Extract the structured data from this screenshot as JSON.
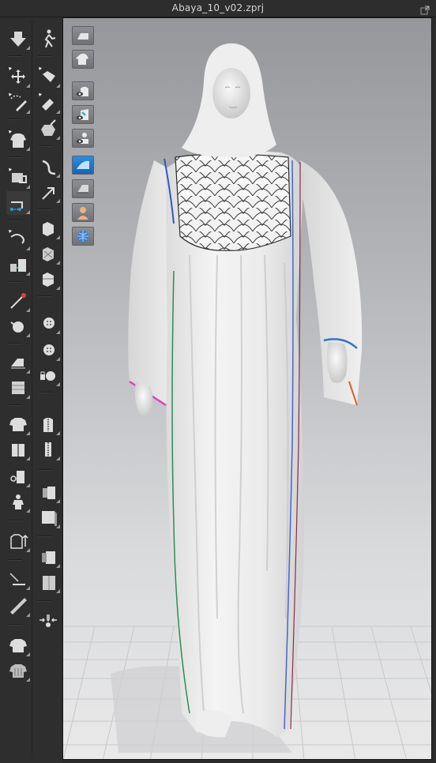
{
  "window": {
    "title": "Abaya_10_v02.zprj"
  },
  "icons": {
    "popout": "popout-icon"
  },
  "toolbar": {
    "left_tools": [
      "simulation-icon",
      "transform-pattern-icon",
      "edit-pattern-icon",
      "segment-tool-icon",
      "select-mesh-icon",
      "pin-icon",
      "edit-curvature-icon",
      "sewing-icon",
      "tack-icon",
      "fold-arrangement-icon",
      "stitch-icon",
      "pucker-icon",
      "buttons-icon",
      "topstitch-icon",
      "measure-icon",
      "avatar-size-icon"
    ],
    "right_tools": [
      "walk-avatar-icon",
      "move-pattern-icon",
      "puller-icon",
      "pin-select-icon",
      "strengthen-icon",
      "shrinkage-icon",
      "fit-icon",
      "texture-edit-icon",
      "fabric-icon",
      "button-icon",
      "buttonhole-icon",
      "zipper-icon",
      "piping-icon",
      "trim-icon",
      "graphic-icon",
      "seam-taping-icon",
      "bind-icon"
    ]
  },
  "viewport_tools": [
    "show-pattern-icon",
    "show-garment-icon",
    "show-3d-garment-icon",
    "show-internal-lines-icon",
    "show-avatar-icon",
    "render-mode-icon",
    "fabric-thickness-icon",
    "show-skin-icon",
    "show-world-icon"
  ]
}
